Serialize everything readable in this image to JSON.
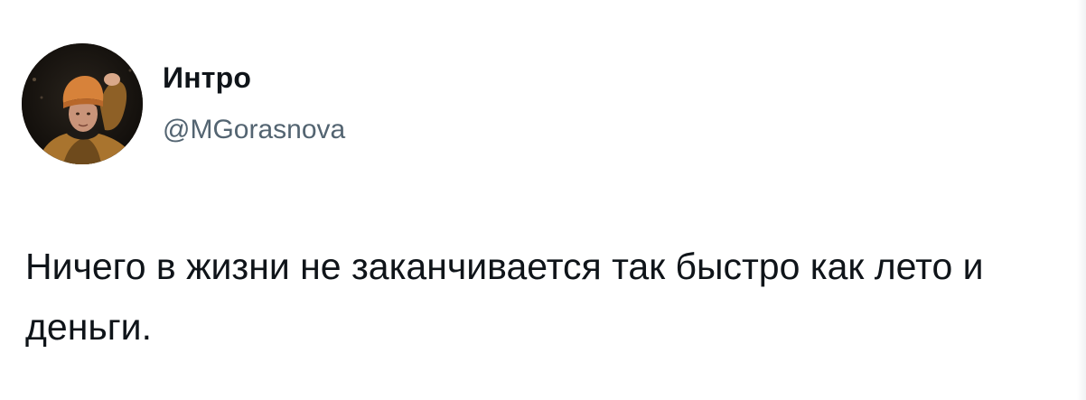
{
  "author": {
    "display_name": "Интро",
    "handle": "@MGorasnova",
    "avatar_icon": "user-avatar-photo"
  },
  "tweet": {
    "text": "Ничего в жизни не заканчивается так быстро как лето и деньги."
  },
  "colors": {
    "name": "#0f1419",
    "handle": "#536471",
    "text": "#0f1419",
    "avatar_bg": "#18140f",
    "hat": "#d7823a"
  }
}
